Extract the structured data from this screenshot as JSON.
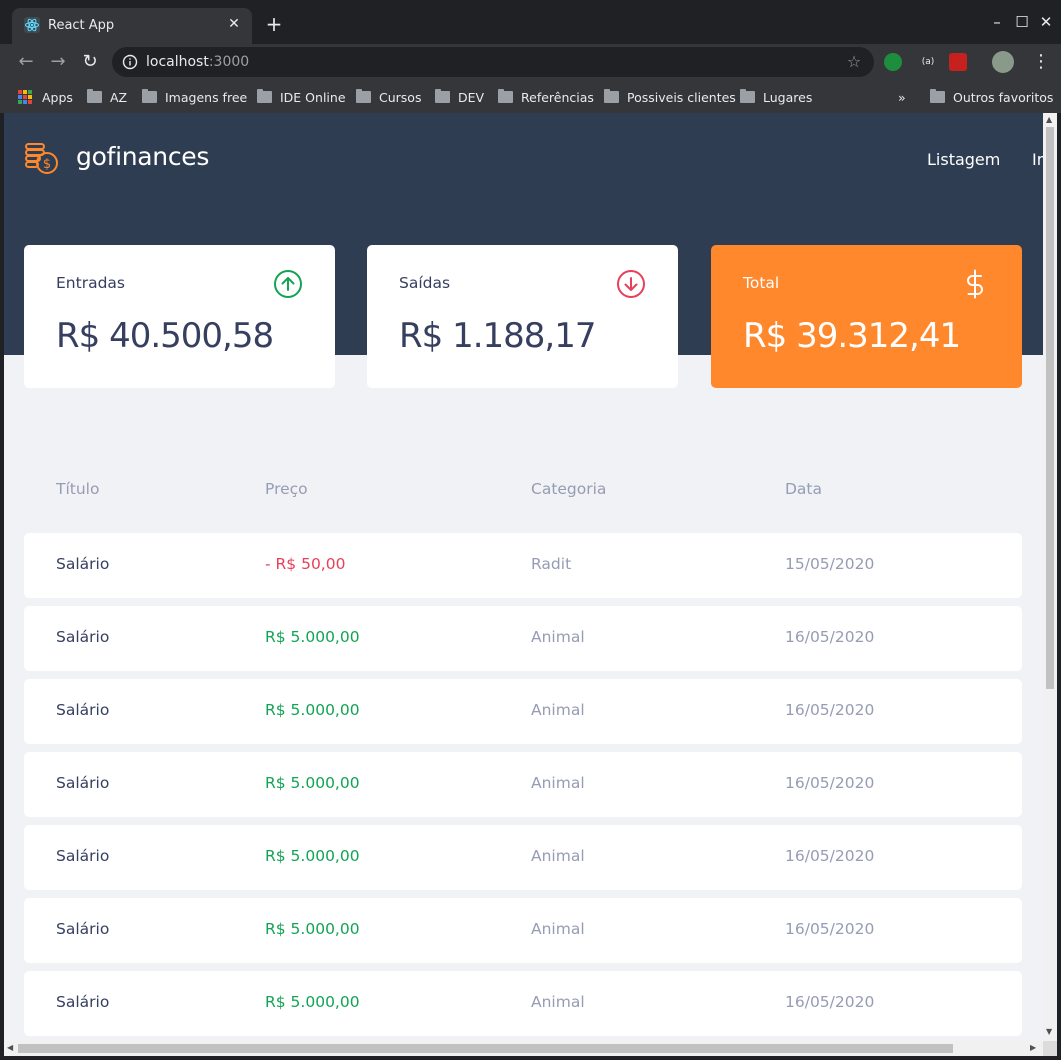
{
  "browser": {
    "tab_title": "React App",
    "url_host": "localhost",
    "url_port": ":3000",
    "bookmarks": [
      {
        "label": "Apps",
        "type": "apps"
      },
      {
        "label": "AZ",
        "type": "folder"
      },
      {
        "label": "Imagens free",
        "type": "folder"
      },
      {
        "label": "IDE Online",
        "type": "folder"
      },
      {
        "label": "Cursos",
        "type": "folder"
      },
      {
        "label": "DEV",
        "type": "folder"
      },
      {
        "label": "Referências",
        "type": "folder"
      },
      {
        "label": "Possiveis clientes",
        "type": "folder"
      },
      {
        "label": "Lugares",
        "type": "folder"
      }
    ],
    "overflow": "»",
    "other_bookmarks": "Outros favoritos",
    "ext_badge": "(a)"
  },
  "app": {
    "brand": "gofinances",
    "nav": [
      "Listagem",
      "Importar"
    ],
    "colors": {
      "header": "#2e3d51",
      "accent": "#ff872c",
      "income": "#12a454",
      "outcome": "#e83f5b",
      "text": "#363f5f",
      "muted": "#969cb3"
    }
  },
  "cards": {
    "income": {
      "label": "Entradas",
      "value": "R$ 40.500,58",
      "icon": "arrow-up-circle-icon"
    },
    "outcome": {
      "label": "Saídas",
      "value": "R$ 1.188,17",
      "icon": "arrow-down-circle-icon"
    },
    "total": {
      "label": "Total",
      "value": "R$ 39.312,41",
      "icon": "dollar-sign-icon"
    }
  },
  "table": {
    "headers": [
      "Título",
      "Preço",
      "Categoria",
      "Data"
    ],
    "rows": [
      {
        "title": "Salário",
        "price": "- R$ 50,00",
        "type": "outcome",
        "category": "Radit",
        "date": "15/05/2020"
      },
      {
        "title": "Salário",
        "price": "R$ 5.000,00",
        "type": "income",
        "category": "Animal",
        "date": "16/05/2020"
      },
      {
        "title": "Salário",
        "price": "R$ 5.000,00",
        "type": "income",
        "category": "Animal",
        "date": "16/05/2020"
      },
      {
        "title": "Salário",
        "price": "R$ 5.000,00",
        "type": "income",
        "category": "Animal",
        "date": "16/05/2020"
      },
      {
        "title": "Salário",
        "price": "R$ 5.000,00",
        "type": "income",
        "category": "Animal",
        "date": "16/05/2020"
      },
      {
        "title": "Salário",
        "price": "R$ 5.000,00",
        "type": "income",
        "category": "Animal",
        "date": "16/05/2020"
      },
      {
        "title": "Salário",
        "price": "R$ 5.000,00",
        "type": "income",
        "category": "Animal",
        "date": "16/05/2020"
      }
    ]
  }
}
